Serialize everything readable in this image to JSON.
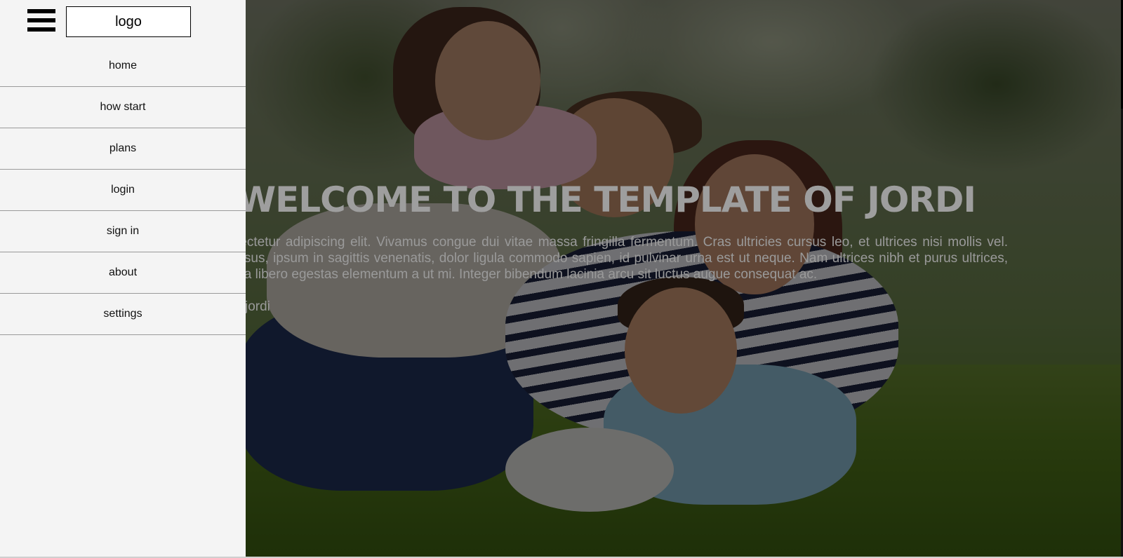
{
  "header": {
    "menu_icon": "hamburger-menu-icon",
    "logo_text": "logo"
  },
  "sidebar": {
    "items": [
      {
        "label": "home"
      },
      {
        "label": "how start"
      },
      {
        "label": "plans"
      },
      {
        "label": "login"
      },
      {
        "label": "sign in"
      },
      {
        "label": "about"
      },
      {
        "label": "settings"
      }
    ]
  },
  "hero": {
    "title": "WELCOME TO THE TEMPLATE OF JORDI",
    "body": "Lorem ipsum dolor sit amet, consectetur adipiscing elit. Vivamus congue dui vitae massa fringilla fermentum. Cras ultricies cursus leo, et ultrices nisi mollis vel. Phasellus vel mattis magna. Ut cursus, ipsum in sagittis venenatis, dolor ligula commodo sapien, id pulvinar urna est ut neque. Nam ultrices nibh et purus ultrices, nec porttitor ex iaculis. Fusce ut ex a libero egestas elementum a ut mi. Integer bibendum lacinia arcu sit luctus augue consequat ac.",
    "author": "jordi"
  },
  "colors": {
    "sidebar_bg": "#f4f4f4",
    "overlay": "rgba(0,0,0,0.52)",
    "hero_text": "#9e9e9e"
  }
}
